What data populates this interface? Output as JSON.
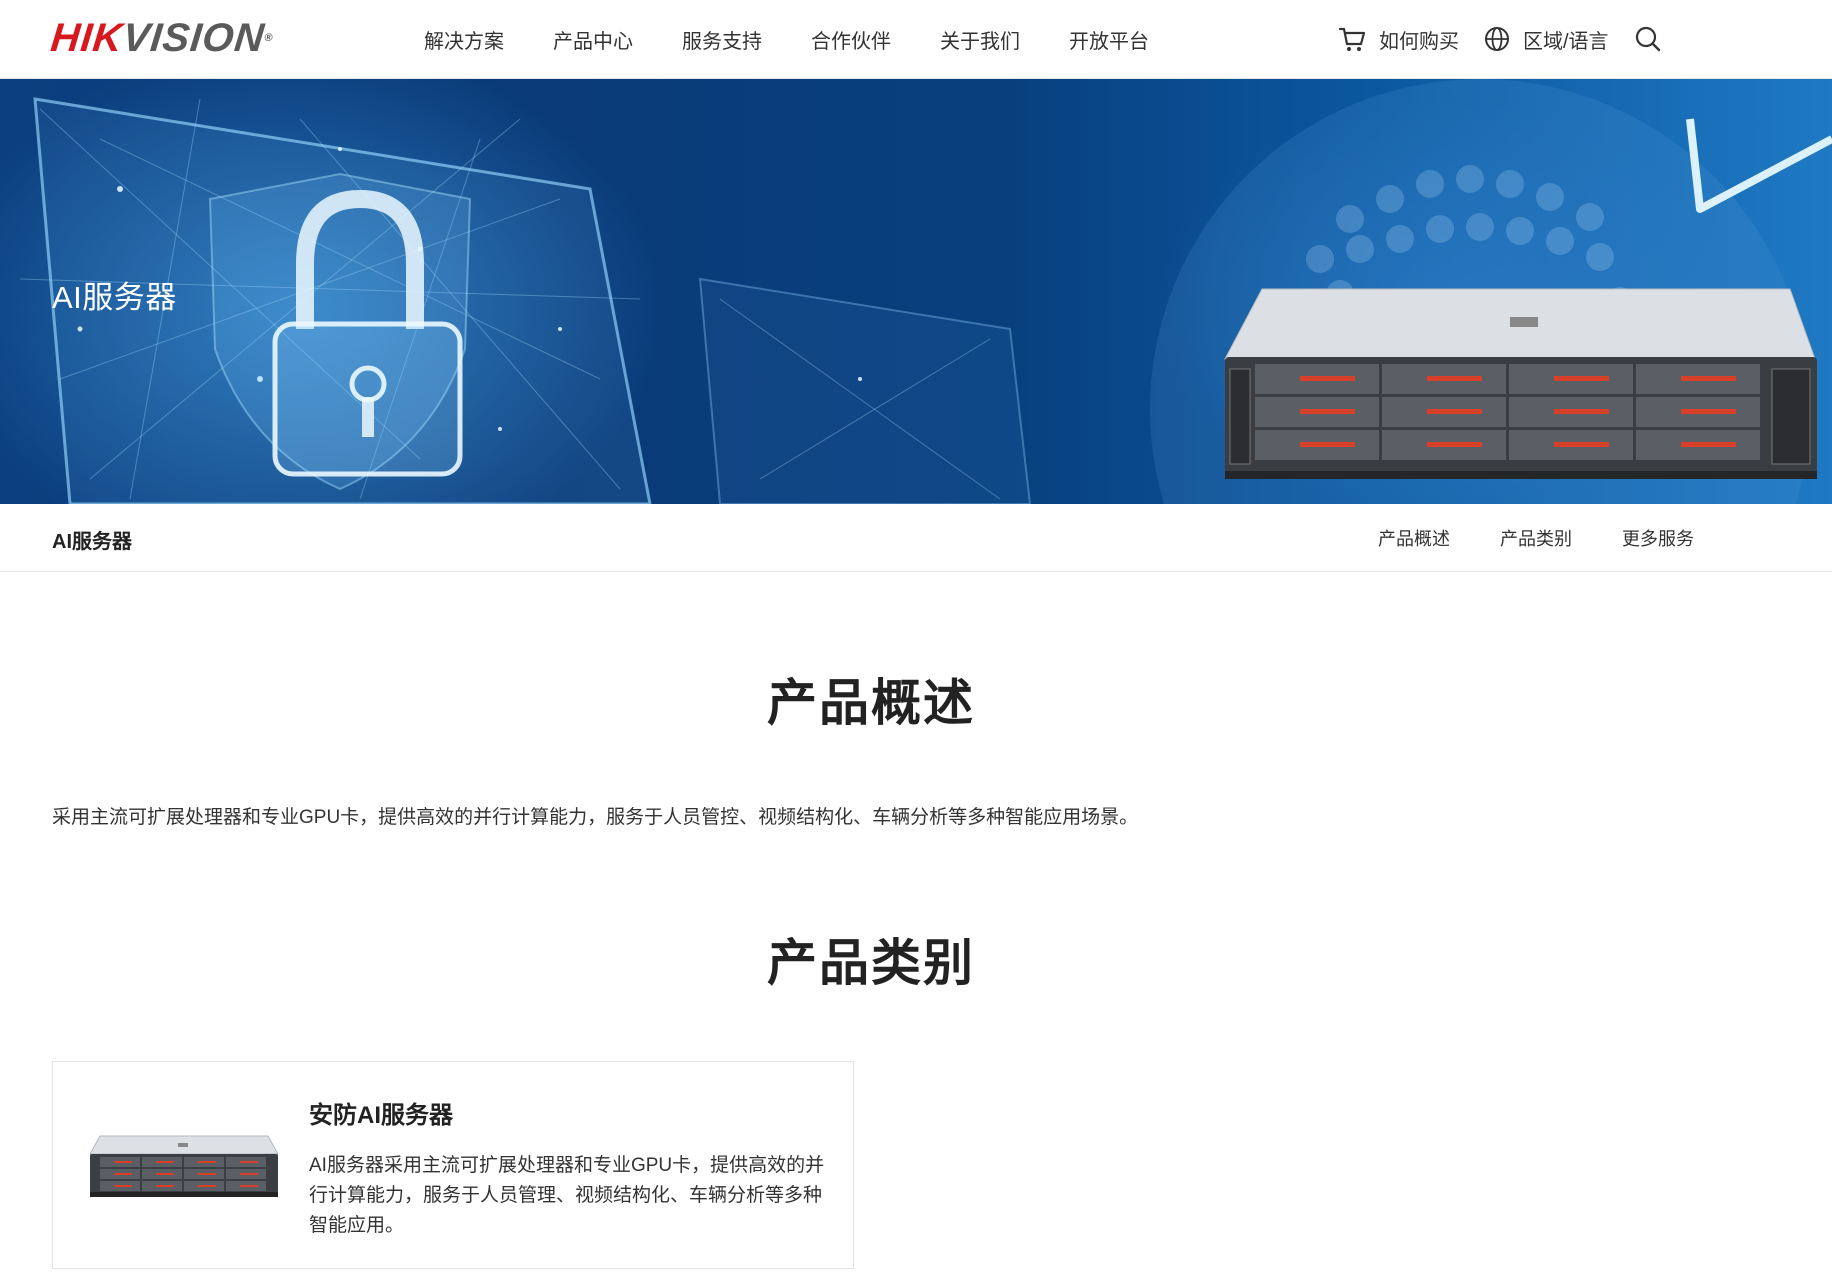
{
  "header": {
    "logo_text_red": "HIK",
    "logo_text_grey": "VISION",
    "logo_mark": "®",
    "nav": [
      "解决方案",
      "产品中心",
      "服务支持",
      "合作伙伴",
      "关于我们",
      "开放平台"
    ],
    "buy_label": "如何购买",
    "region_label": "区域/语言",
    "icons": {
      "cart": "cart-icon",
      "globe": "globe-icon",
      "search": "search-icon"
    }
  },
  "banner": {
    "title": "AI服务器"
  },
  "subnav": {
    "title": "AI服务器",
    "links": [
      "产品概述",
      "产品类别",
      "更多服务"
    ]
  },
  "overview": {
    "title": "产品概述",
    "text": "采用主流可扩展处理器和专业GPU卡，提供高效的并行计算能力，服务于人员管控、视频结构化、车辆分析等多种智能应用场景。"
  },
  "categories": {
    "title": "产品类别",
    "cards": [
      {
        "title": "安防AI服务器",
        "desc": "AI服务器采用主流可扩展处理器和专业GPU卡，提供高效的并行计算能力，服务于人员管理、视频结构化、车辆分析等多种智能应用。"
      }
    ]
  },
  "colors": {
    "brand_red": "#d7181f",
    "banner_blue": "#0b3f7f",
    "text_dark": "#222222"
  }
}
